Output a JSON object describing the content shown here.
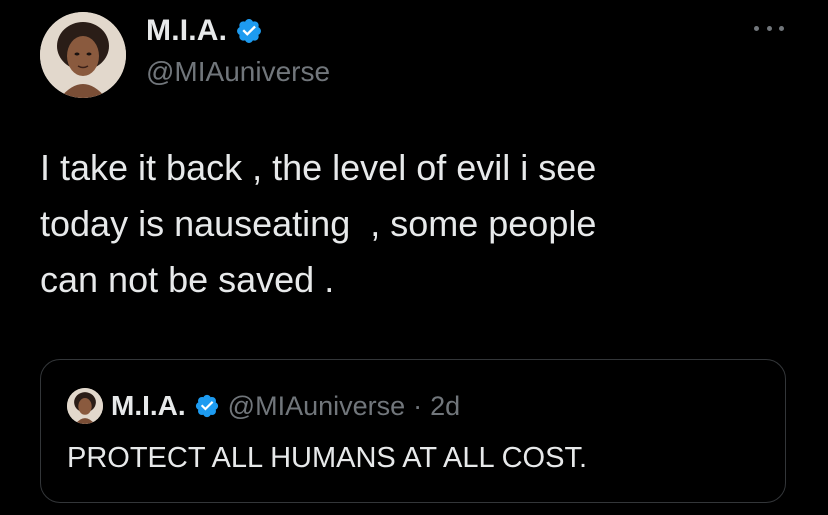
{
  "tweet": {
    "author": {
      "display_name": "M.I.A.",
      "handle": "@MIAuniverse",
      "verified": true,
      "verified_icon": "verified-badge-icon"
    },
    "menu_icon": "more-options-icon",
    "text": "I take it back , the level of evil i see\ntoday is nauseating  , some people\ncan not be saved ."
  },
  "quote_tweet": {
    "author": {
      "display_name": "M.I.A.",
      "handle": "@MIAuniverse",
      "verified": true
    },
    "separator": "·",
    "time": "2d",
    "text": "PROTECT ALL HUMANS AT ALL COST."
  },
  "colors": {
    "background": "#000000",
    "primary_text": "#e7e9ea",
    "secondary_text": "#71767b",
    "verified_blue": "#1d9bf0",
    "border": "#333639"
  }
}
